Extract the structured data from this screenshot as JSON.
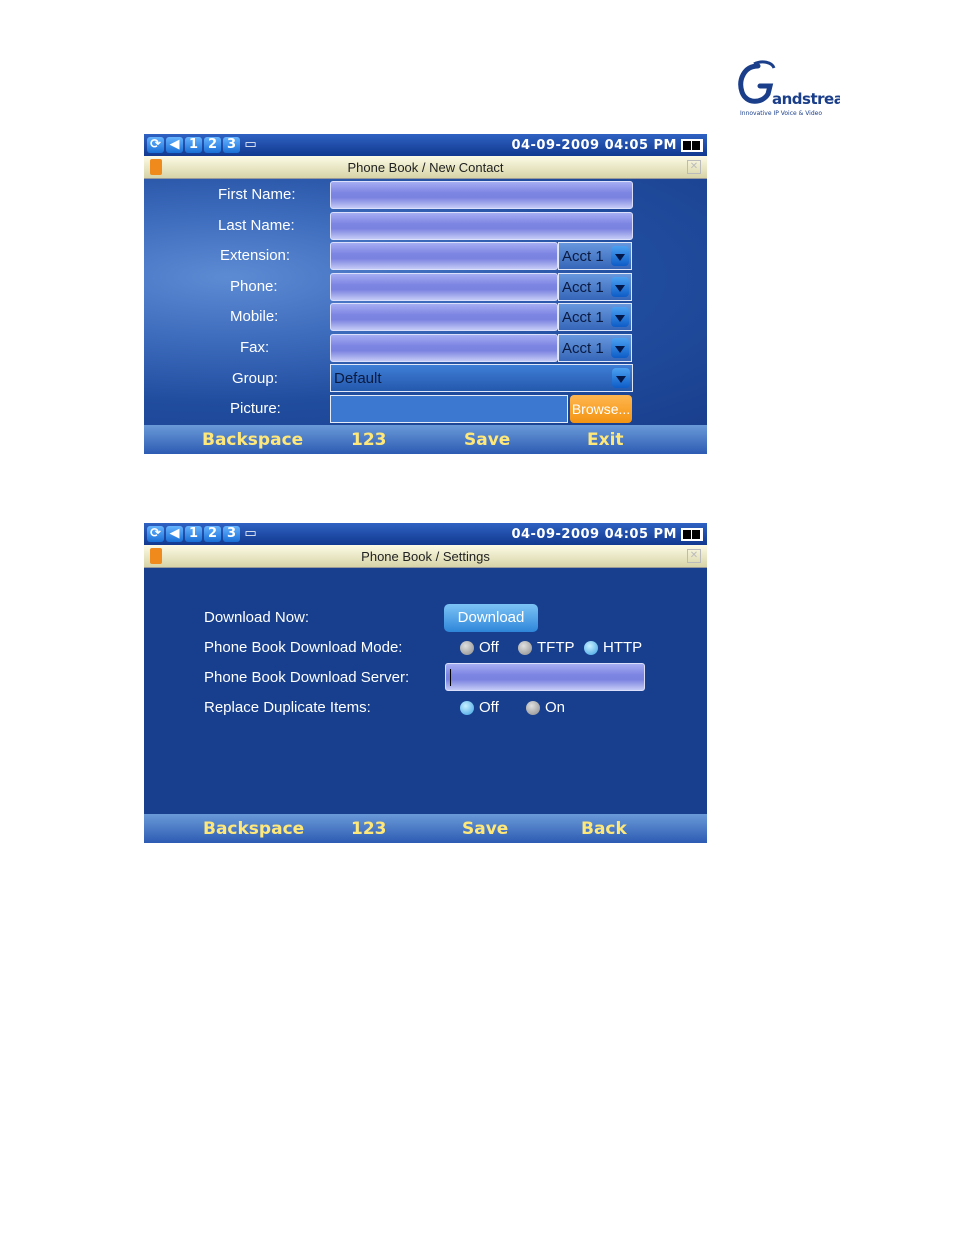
{
  "logo": {
    "text": "Grandstream",
    "tagline": "Innovative IP Voice & Video"
  },
  "status_bar": {
    "icons": [
      "sync-icon",
      "volume-icon",
      "1",
      "2",
      "3",
      "folder-icon"
    ],
    "datetime": "04-09-2009 04:05 PM",
    "battery": "battery-icon"
  },
  "screen1": {
    "title": "Phone Book / New Contact",
    "labels": {
      "first_name": "First Name:",
      "last_name": "Last Name:",
      "extension": "Extension:",
      "phone": "Phone:",
      "mobile": "Mobile:",
      "fax": "Fax:",
      "group": "Group:",
      "picture": "Picture:"
    },
    "acct_extension": "Acct 1",
    "acct_phone": "Acct 1",
    "acct_mobile": "Acct 1",
    "acct_fax": "Acct 1",
    "group_value": "Default",
    "browse_label": "Browse...",
    "softkeys": [
      "Backspace",
      "123",
      "Save",
      "Exit"
    ]
  },
  "screen2": {
    "title": "Phone Book / Settings",
    "download_now_label": "Download Now:",
    "download_button": "Download",
    "mode_label": "Phone Book Download Mode:",
    "mode_options": [
      "Off",
      "TFTP",
      "HTTP"
    ],
    "mode_selected": "HTTP",
    "server_label": "Phone Book Download Server:",
    "server_value": "",
    "replace_label": "Replace Duplicate Items:",
    "replace_options": [
      "Off",
      "On"
    ],
    "replace_selected": "Off",
    "softkeys": [
      "Backspace",
      "123",
      "Save",
      "Back"
    ]
  }
}
